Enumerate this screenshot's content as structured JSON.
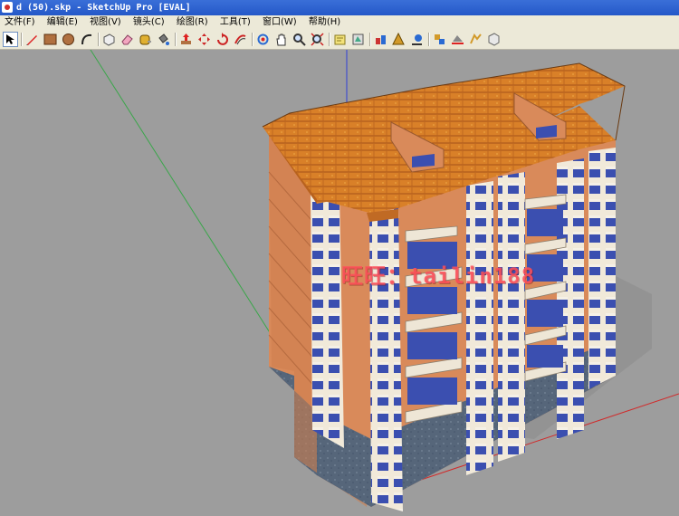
{
  "window": {
    "title": "d (50).skp - SketchUp Pro [EVAL]"
  },
  "menu": [
    "文件(F)",
    "编辑(E)",
    "视图(V)",
    "镜头(C)",
    "绘图(R)",
    "工具(T)",
    "窗口(W)",
    "帮助(H)"
  ],
  "toolbar": {
    "tools": [
      "select",
      "pencil",
      "rectangle",
      "circle",
      "arc",
      "make-component",
      "eraser",
      "tape-measure",
      "paint-bucket",
      "push-pull",
      "move",
      "rotate",
      "offset",
      "orbit",
      "pan",
      "zoom",
      "zoom-extents",
      "get-models",
      "share-model",
      "component",
      "layers",
      "sun",
      "shadows",
      "fog",
      "styles"
    ],
    "active_tool": "select"
  },
  "viewport": {
    "watermark": "旺旺：tailin188"
  },
  "colors": {
    "background": "#9d9d9d",
    "roof": "#d97b24",
    "wall": "#d98a5a",
    "base": "#586578",
    "glass": "#3b4fb0",
    "axis_red": "#d12b2b",
    "axis_green": "#3aa64a",
    "axis_blue": "#2f3fd6"
  }
}
